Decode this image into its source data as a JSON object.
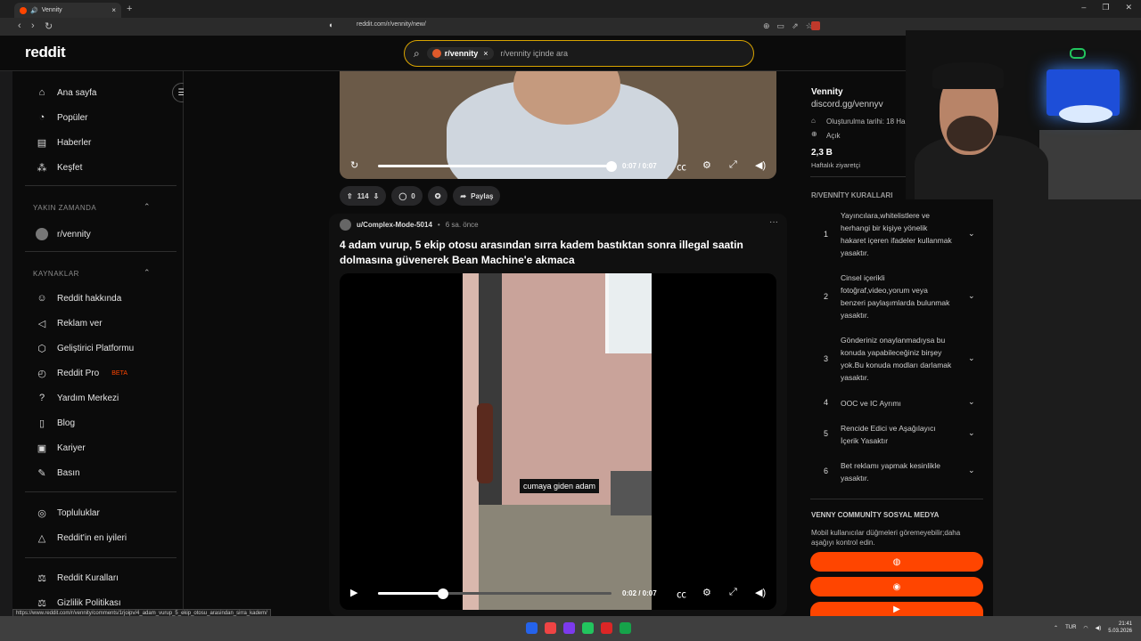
{
  "browser": {
    "tab_title": "Vennity",
    "tab_close": "×",
    "new_tab": "+",
    "url": "reddit.com/r/vennity/new/",
    "window_controls": [
      "–",
      "❐",
      "✕"
    ]
  },
  "header": {
    "logo": "reddit",
    "search_chip": "r/vennity",
    "search_chip_close": "×",
    "search_placeholder": "r/vennity içinde ara"
  },
  "sidebar": {
    "nav": [
      {
        "label": "Ana sayfa",
        "icon": "home-icon"
      },
      {
        "label": "Popüler",
        "icon": "popular-icon"
      },
      {
        "label": "Haberler",
        "icon": "news-icon"
      },
      {
        "label": "Keşfet",
        "icon": "explore-icon"
      }
    ],
    "recent_heading": "YAKIN ZAMANDA",
    "recent_items": [
      {
        "label": "r/vennity"
      }
    ],
    "resources_heading": "KAYNAKLAR",
    "resources": [
      {
        "label": "Reddit hakkında",
        "icon": "reddit-icon"
      },
      {
        "label": "Reklam ver",
        "icon": "megaphone-icon"
      },
      {
        "label": "Geliştirici Platformu",
        "icon": "developer-icon"
      },
      {
        "label": "Reddit Pro",
        "badge": "BETA",
        "icon": "pro-icon"
      },
      {
        "label": "Yardım Merkezi",
        "icon": "help-icon"
      },
      {
        "label": "Blog",
        "icon": "blog-icon"
      },
      {
        "label": "Kariyer",
        "icon": "briefcase-icon"
      },
      {
        "label": "Basın",
        "icon": "press-icon"
      }
    ],
    "communities": [
      {
        "label": "Topluluklar",
        "icon": "communities-icon"
      },
      {
        "label": "Reddit'in en iyileri",
        "icon": "best-icon"
      }
    ],
    "policies": [
      {
        "label": "Reddit Kuralları",
        "icon": "rules-icon"
      },
      {
        "label": "Gizlilik Politikası",
        "icon": "privacy-icon"
      }
    ]
  },
  "post1": {
    "video_time": "0:07 / 0:07",
    "video_progress": 1.0,
    "votes": "114",
    "comments": "0",
    "share": "Paylaş"
  },
  "post2": {
    "author": "u/Complex-Mode-5014",
    "separator": "•",
    "time": "6 sa. önce",
    "more": "···",
    "title": "4 adam vurup, 5 ekip otosu arasından sırra kadem bastıktan sonra illegal saatin dolmasına güvenerek Bean Machine'e akmaca",
    "caption": "cumaya giden adam",
    "video_time": "0:02 / 0:07",
    "video_progress": 0.28
  },
  "right_sidebar": {
    "community_name": "Vennity",
    "community_link": "discord.gg/vennyv",
    "created": "Oluşturulma tarihi: 18 Ha",
    "visibility": "Açık",
    "weekly_visitors": "2,3 B",
    "weekly_label": "Haftalık ziyaretçi",
    "rules_heading": "R/VENNİTY KURALLARI",
    "rules": [
      {
        "num": "1",
        "text": "Yayıncılara,whitelistlere ve herhangi bir kişiye yönelik hakaret içeren ifadeler kullanmak yasaktır."
      },
      {
        "num": "2",
        "text": "Cinsel içerikli fotoğraf,video,yorum veya benzeri paylaşımlarda bulunmak yasaktır."
      },
      {
        "num": "3",
        "text": "Gönderiniz onaylanmadıysa bu konuda yapabileceğiniz birşey yok.Bu konuda modları darlamak yasaktır."
      },
      {
        "num": "4",
        "text": "OOC ve IC Ayrımı"
      },
      {
        "num": "5",
        "text": "Rencide Edici ve Aşağılayıcı İçerik Yasaktır"
      },
      {
        "num": "6",
        "text": "Bet reklamı yapmak kesinlikle yasaktır."
      }
    ],
    "social_heading": "VENNY COMMUNİTY SOSYAL MEDYA",
    "social_note": "Mobil kullanıcılar düğmeleri göremeyebilir;daha aşağıyı kontrol edin.",
    "social_buttons": [
      "web-icon",
      "discord-icon",
      "youtube-icon"
    ]
  },
  "status_link": "https://www.reddit.com/r/vennity/comments/1rjoipv/4_adam_vurup_5_ekip_otosu_arasindan_sirra_kadem/",
  "taskbar": {
    "lang": "TUR",
    "time": "21:41",
    "date": "5.03.2026"
  },
  "colors": {
    "accent": "#ff4500",
    "search_border": "#d9a400",
    "background": "#0b0b0b"
  }
}
